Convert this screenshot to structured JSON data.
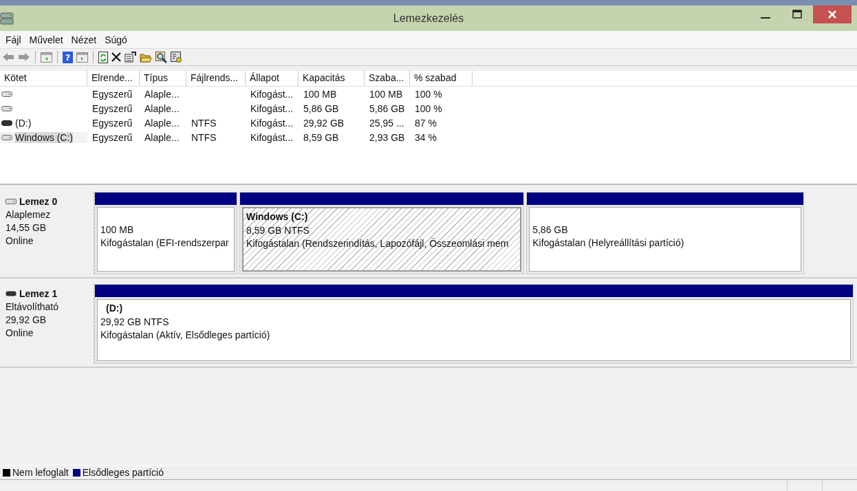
{
  "window": {
    "title": "Lemezkezelés"
  },
  "menu": [
    "Fájl",
    "Művelet",
    "Nézet",
    "Súgó"
  ],
  "toolbar": {
    "help_icon": "?"
  },
  "volumes": {
    "columns": [
      "Kötet",
      "Elrende...",
      "Típus",
      "Fájlrends...",
      "Állapot",
      "Kapacitás",
      "Szaba...",
      "% szabad"
    ],
    "rows": [
      {
        "kind": "basic",
        "cells": [
          "",
          "Egyszerű",
          "Alaple...",
          "",
          "Kifogást...",
          "100 MB",
          "100 MB",
          "100 %"
        ],
        "selected": false
      },
      {
        "kind": "basic",
        "cells": [
          "",
          "Egyszerű",
          "Alaple...",
          "",
          "Kifogást...",
          "5,86 GB",
          "5,86 GB",
          "100 %"
        ],
        "selected": false
      },
      {
        "kind": "removable",
        "cells": [
          "(D:)",
          "Egyszerű",
          "Alaple...",
          "NTFS",
          "Kifogást...",
          "29,92 GB",
          "25,95 ...",
          "87 %"
        ],
        "selected": false
      },
      {
        "kind": "basic",
        "cells": [
          "Windows (C:)",
          "Egyszerű",
          "Alaple...",
          "NTFS",
          "Kifogást...",
          "8,59 GB",
          "2,93 GB",
          "34 %"
        ],
        "selected": true
      }
    ]
  },
  "disks": [
    {
      "kind": "basic",
      "name": "Lemez 0",
      "type": "Alaplemez",
      "size": "14,55 GB",
      "status": "Online",
      "partitions": [
        {
          "size": "100 MB",
          "status": "Kifogástalan (EFI-rendszerpar",
          "selected": false
        },
        {
          "name": "Windows  (C:)",
          "size": "8,59 GB NTFS",
          "status": "Kifogástalan (Rendszerindítás, Lapozófájl, Összeomlási mem",
          "selected": true
        },
        {
          "size": "5,86 GB",
          "status": "Kifogástalan (Helyreállítási partíció)",
          "selected": false
        }
      ]
    },
    {
      "kind": "removable",
      "name": "Lemez 1",
      "type": "Eltávolítható",
      "size": "29,92 GB",
      "status": "Online",
      "partitions": [
        {
          "name": "(D:)",
          "size": "29,92 GB NTFS",
          "status": "Kifogástalan (Aktív, Elsődleges partíció)",
          "selected": false
        }
      ]
    }
  ],
  "legend": [
    {
      "label": "Nem lefoglalt",
      "color": "#000000"
    },
    {
      "label": "Elsődleges partíció",
      "color": "#000080"
    }
  ]
}
